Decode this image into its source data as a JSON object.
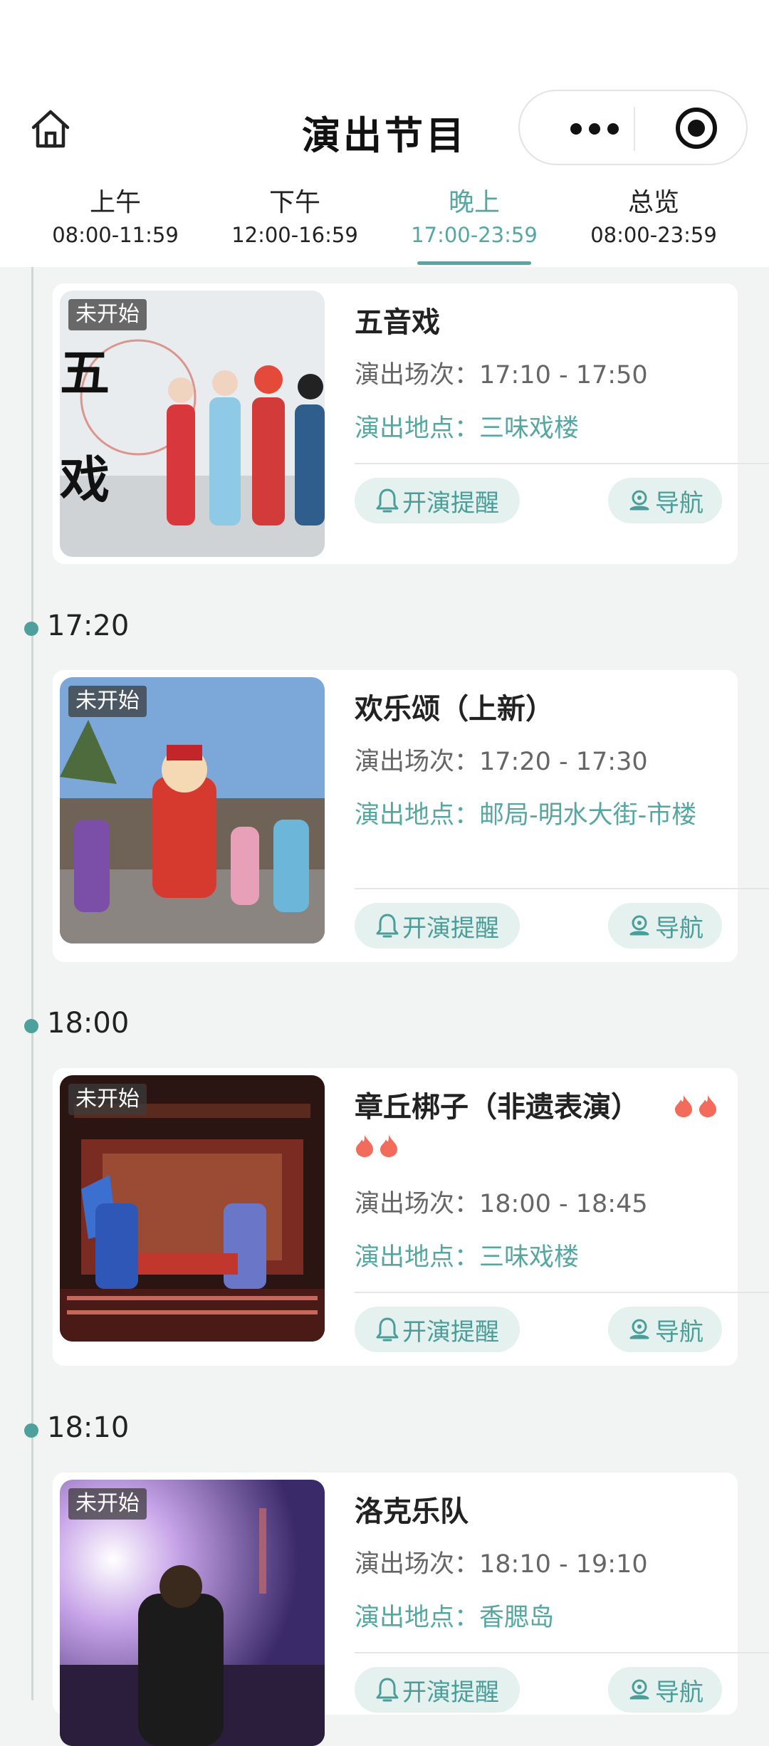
{
  "header": {
    "title": "演出节目",
    "icons": {
      "home": "home-icon",
      "more": "more-dots-icon",
      "close": "target-icon"
    }
  },
  "tabs": [
    {
      "label": "上午",
      "time": "08:00-11:59",
      "active": false
    },
    {
      "label": "下午",
      "time": "12:00-16:59",
      "active": false
    },
    {
      "label": "晚上",
      "time": "17:00-23:59",
      "active": true
    },
    {
      "label": "总览",
      "time": "08:00-23:59",
      "active": false
    }
  ],
  "labels": {
    "session_prefix": "演出场次：",
    "location_prefix": "演出地点：",
    "remind_button": "开演提醒",
    "nav_button": "导航"
  },
  "shows": [
    {
      "group_time": "",
      "status": "未开始",
      "title": "五音戏",
      "hot_count": 0,
      "session": "17:10 - 17:50",
      "location": "三味戏楼"
    },
    {
      "group_time": "17:20",
      "status": "未开始",
      "title": "欢乐颂（上新）",
      "hot_count": 0,
      "session": "17:20 - 17:30",
      "location": "邮局-明水大街-市楼"
    },
    {
      "group_time": "18:00",
      "status": "未开始",
      "title": "章丘梆子（非遗表演）",
      "hot_count": 4,
      "session": "18:00 - 18:45",
      "location": "三味戏楼"
    },
    {
      "group_time": "18:10",
      "status": "未开始",
      "title": "洛克乐队",
      "hot_count": 0,
      "session": "18:10 - 19:10",
      "location": "香腮岛"
    }
  ],
  "colors": {
    "accent": "#56a6a2",
    "button_bg": "#e4f1ef",
    "flame": "#f26b5b"
  }
}
